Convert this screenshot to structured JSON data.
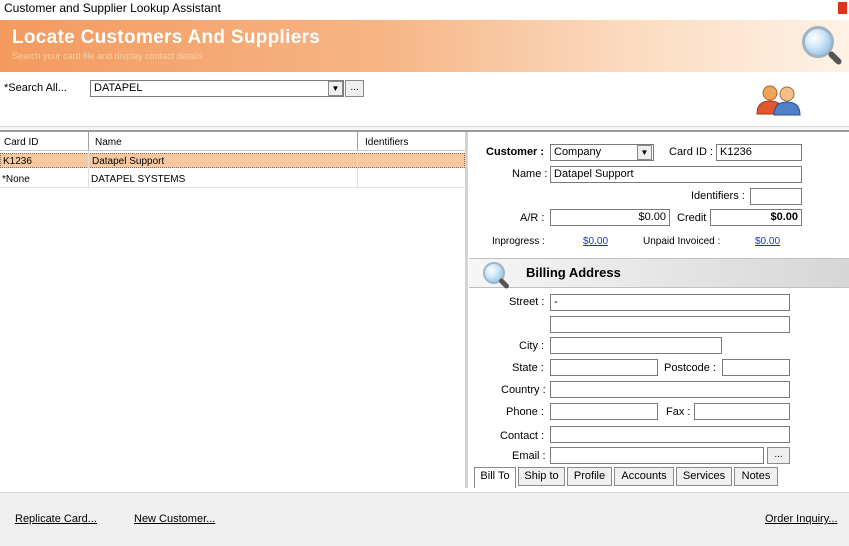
{
  "window": {
    "title": "Customer and Supplier Lookup Assistant"
  },
  "banner": {
    "heading": "Locate Customers And Suppliers",
    "subtitle": "Search your card file and display contact details"
  },
  "search": {
    "label": "*Search All...",
    "value": "DATAPEL",
    "browse_label": "..."
  },
  "grid": {
    "columns": [
      "Card ID",
      "Name",
      "Identifiers"
    ],
    "rows": [
      {
        "card_id": "K1236",
        "name": "Datapel Support",
        "identifiers": "",
        "selected": true
      },
      {
        "card_id": "*None",
        "name": "DATAPEL SYSTEMS",
        "identifiers": "",
        "selected": false
      }
    ]
  },
  "detail": {
    "customer_label": "Customer :",
    "customer_type": "Company",
    "card_id_label": "Card ID :",
    "card_id": "K1236",
    "name_label": "Name :",
    "name": "Datapel Support",
    "identifiers_label": "Identifiers :",
    "identifiers": "",
    "ar_label": "A/R :",
    "ar": "$0.00",
    "credit_limit_label": "Credit Limit :",
    "credit_limit": "$0.00",
    "inprogress_label": "Inprogress :",
    "inprogress": "$0.00",
    "unpaid_label": "Unpaid Invoiced :",
    "unpaid": "$0.00"
  },
  "billing": {
    "heading": "Billing Address",
    "street_label": "Street :",
    "street1": "-",
    "street2": "",
    "city_label": "City :",
    "city": "",
    "state_label": "State :",
    "state": "",
    "postcode_label": "Postcode :",
    "postcode": "",
    "country_label": "Country :",
    "country": "",
    "phone_label": "Phone :",
    "phone": "",
    "fax_label": "Fax :",
    "fax": "",
    "contact_label": "Contact :",
    "contact": "",
    "email_label": "Email :",
    "email": "",
    "email_btn": "..."
  },
  "tabs": [
    "Bill To",
    "Ship to",
    "Profile",
    "Accounts",
    "Services",
    "Notes"
  ],
  "footer": {
    "replicate": "Replicate Card...",
    "new_customer": "New Customer...",
    "order_inquiry": "Order Inquiry..."
  },
  "colors": {
    "selected_row": "#f8c9a0",
    "banner_accent": "#f49a5f",
    "link": "#1a36c4"
  }
}
